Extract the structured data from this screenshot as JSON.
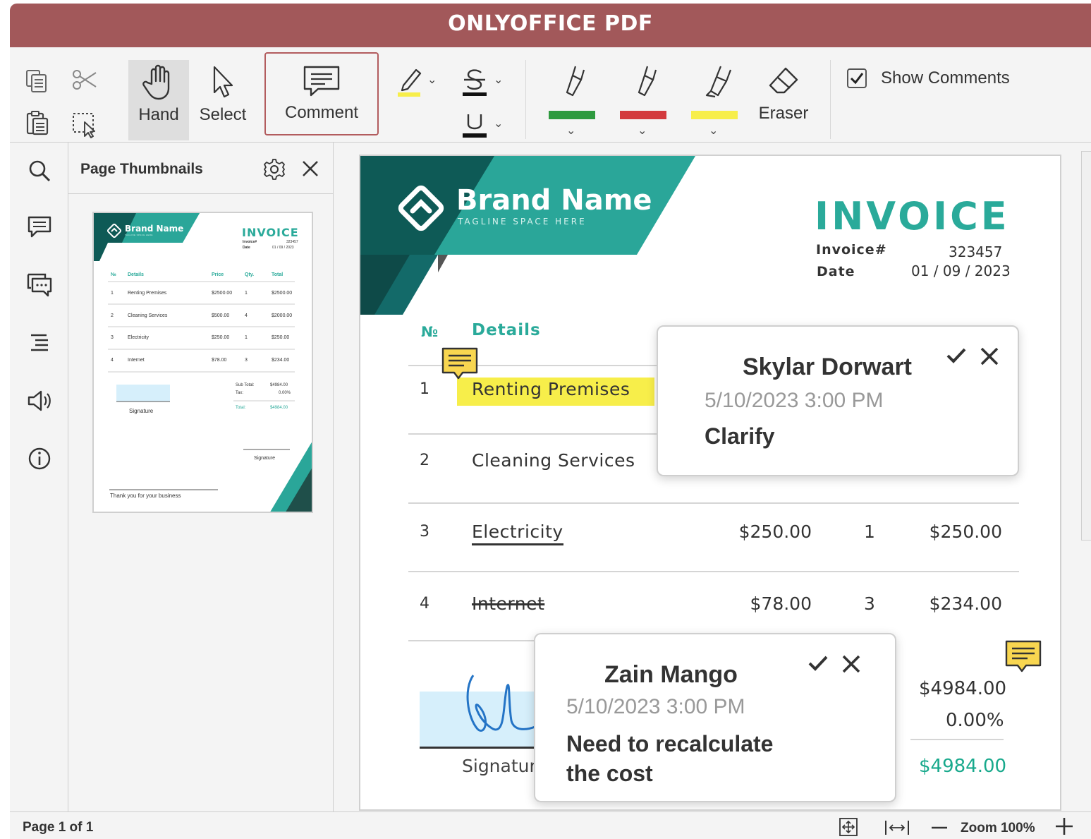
{
  "app": {
    "title": "ONLYOFFICE PDF"
  },
  "toolbar": {
    "hand": "Hand",
    "select": "Select",
    "comment": "Comment",
    "eraser": "Eraser",
    "show_comments": "Show Comments",
    "highlight_colors": [
      "#2e9a3f",
      "#d33a3e",
      "#f7ee4a"
    ]
  },
  "thumbnails": {
    "title": "Page Thumbnails",
    "mini": {
      "brand": "Brand Name",
      "tagline": "TAGLINE SPACE HERE",
      "invoice": "INVOICE",
      "invoice_no_label": "Invoice#",
      "invoice_no": "323457",
      "date_label": "Date",
      "date": "01 / 09 / 2023",
      "headers": [
        "№",
        "Details",
        "Price",
        "Qty.",
        "Total"
      ],
      "rows": [
        [
          "1",
          "Renting Premises",
          "$2500.00",
          "1",
          "$2500.00"
        ],
        [
          "2",
          "Cleaning Services",
          "$500.00",
          "4",
          "$2000.00"
        ],
        [
          "3",
          "Electricity",
          "$250.00",
          "1",
          "$250.00"
        ],
        [
          "4",
          "Internet",
          "$78.00",
          "3",
          "$234.00"
        ]
      ],
      "subtotal_label": "Sub Total:",
      "subtotal": "$4984.00",
      "tax_label": "Tax:",
      "tax": "0.00%",
      "total_label": "Total:",
      "total": "$4984.00",
      "signature": "Signature",
      "signature2": "Signature",
      "thanks": "Thank you for your business"
    }
  },
  "invoice": {
    "brand": "Brand Name",
    "tagline": "TAGLINE SPACE HERE",
    "title": "INVOICE",
    "invoice_no_label": "Invoice#",
    "invoice_no": "323457",
    "date_label": "Date",
    "date": "01 / 09 / 2023",
    "col_no": "№",
    "col_details": "Details",
    "rows": [
      {
        "no": "1",
        "details": "Renting Premises",
        "price": "",
        "qty": "",
        "total": ""
      },
      {
        "no": "2",
        "details": "Cleaning Services",
        "price": "",
        "qty": "",
        "total": ""
      },
      {
        "no": "3",
        "details": "Electricity",
        "price": "$250.00",
        "qty": "1",
        "total": "$250.00"
      },
      {
        "no": "4",
        "details": "Internet",
        "price": "$78.00",
        "qty": "3",
        "total": "$234.00"
      }
    ],
    "subtotal": "$4984.00",
    "tax": "0.00%",
    "total": "$4984.00",
    "signature": "Signatur"
  },
  "comments": [
    {
      "author": "Skylar Dorwart",
      "date": "5/10/2023 3:00 PM",
      "text": "Clarify",
      "color": "#9b6bd8"
    },
    {
      "author": "Zain Mango",
      "date": "5/10/2023 3:00 PM",
      "text_line1": "Need to recalculate",
      "text_line2": "the cost",
      "color": "#7ab733"
    }
  ],
  "status": {
    "page": "Page 1 of 1",
    "zoom": "Zoom 100%"
  }
}
